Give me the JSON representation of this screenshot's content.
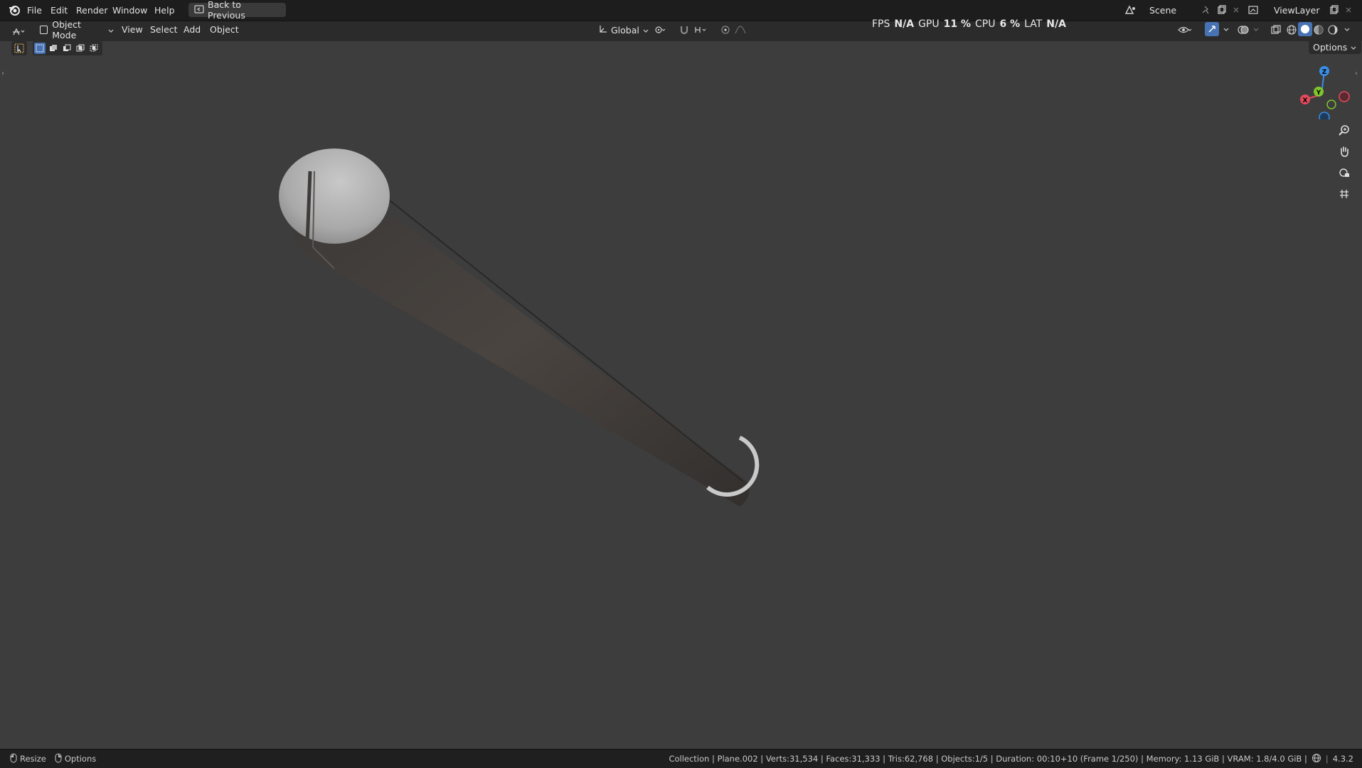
{
  "menu": {
    "file": "File",
    "edit": "Edit",
    "render": "Render",
    "window": "Window",
    "help": "Help",
    "back_button": "Back to Previous"
  },
  "topright": {
    "scene_label": "Scene",
    "viewlayer_label": "ViewLayer"
  },
  "header": {
    "mode": "Object Mode",
    "view": "View",
    "select": "Select",
    "add": "Add",
    "object": "Object",
    "orientation": "Global",
    "options": "Options"
  },
  "perf": {
    "fps_label": "FPS",
    "fps_value": "N/A",
    "gpu_label": "GPU",
    "gpu_value": "11 %",
    "cpu_label": "CPU",
    "cpu_value": "6 %",
    "lat_label": "LAT",
    "lat_value": "N/A"
  },
  "gizmo": {
    "z": "Z",
    "y": "Y",
    "x": "X"
  },
  "status": {
    "resize": "Resize",
    "options": "Options",
    "info": "Collection | Plane.002 | Verts:31,534 | Faces:31,333 | Tris:62,768 | Objects:1/5 | Duration: 00:10+10 (Frame 1/250) | Memory: 1.13 GiB | VRAM: 1.8/4.0 GiB |",
    "version": "4.3.2"
  },
  "colors": {
    "accent": "#4772b3",
    "axis_x": "#e34a5c",
    "axis_y": "#7fc62a",
    "axis_z": "#3a8ee6"
  }
}
